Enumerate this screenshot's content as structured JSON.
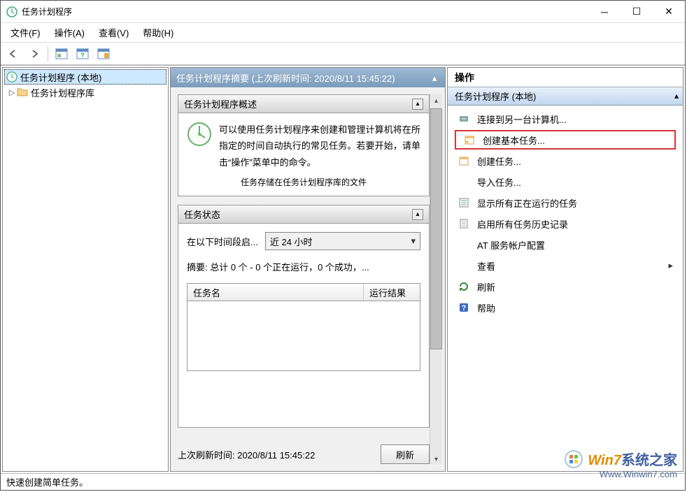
{
  "window": {
    "title": "任务计划程序"
  },
  "menu": {
    "file": "文件(F)",
    "action": "操作(A)",
    "view": "查看(V)",
    "help": "帮助(H)"
  },
  "tree": {
    "root": "任务计划程序 (本地)",
    "child": "任务计划程序库"
  },
  "center": {
    "header": "任务计划程序摘要 (上次刷新时间: 2020/8/11 15:45:22)",
    "overview": {
      "title": "任务计划程序概述",
      "text": "可以使用任务计划程序来创建和管理计算机将在所指定的时间自动执行的常见任务。若要开始，请单击“操作”菜单中的命令。",
      "cutline": "任务存储在任务计划程序库的文件"
    },
    "status": {
      "title": "任务状态",
      "period_label": "在以下时间段启...",
      "period_value": "近 24 小时",
      "summary": "摘要: 总计 0 个 - 0 个正在运行，0 个成功，...",
      "col_name": "任务名",
      "col_result": "运行结果"
    },
    "refresh_ts": "上次刷新时间: 2020/8/11 15:45:22",
    "refresh_btn": "刷新"
  },
  "actions": {
    "title": "操作",
    "subtitle": "任务计划程序 (本地)",
    "items": [
      {
        "label": "连接到另一台计算机...",
        "icon": "link"
      },
      {
        "label": "创建基本任务...",
        "icon": "wizard",
        "highlight": true
      },
      {
        "label": "创建任务...",
        "icon": "task"
      },
      {
        "label": "导入任务...",
        "icon": "import"
      },
      {
        "label": "显示所有正在运行的任务",
        "icon": "running"
      },
      {
        "label": "启用所有任务历史记录",
        "icon": "history"
      },
      {
        "label": "AT 服务帐户配置",
        "icon": "none"
      },
      {
        "label": "查看",
        "icon": "none",
        "submenu": true
      },
      {
        "label": "刷新",
        "icon": "refresh"
      },
      {
        "label": "帮助",
        "icon": "help"
      }
    ]
  },
  "statusbar": "快速创建简单任务。",
  "watermark": {
    "brand1": "Win7",
    "brand2": "系统之家",
    "url": "Www.Winwin7.com"
  }
}
